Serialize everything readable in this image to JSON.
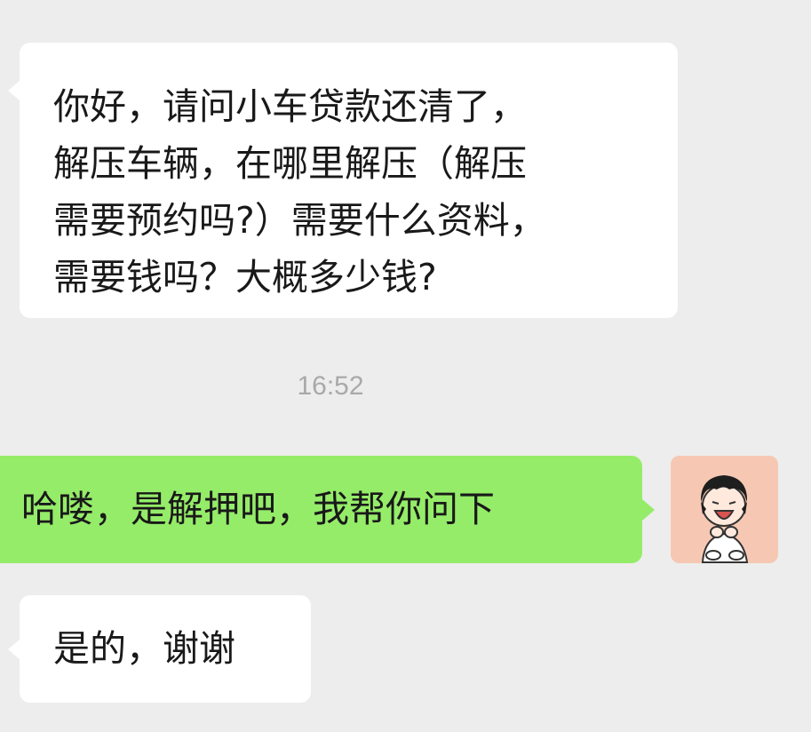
{
  "messages": [
    {
      "sender": "other",
      "text": "你好，请问小车贷款还清了，解压车辆，在哪里解压（解压需要预约吗?）需要什么资料，需要钱吗？大概多少钱?"
    },
    {
      "sender": "self",
      "text": "哈喽，是解押吧，我帮你问下"
    },
    {
      "sender": "other",
      "text": "是的，谢谢"
    }
  ],
  "lines": {
    "m1": [
      "你好，请问小车贷款还清了，",
      "解压车辆，在哪里解压（解压",
      "需要预约吗?）需要什么资料，",
      "需要钱吗？大概多少钱?"
    ]
  },
  "timestamp": "16:52",
  "colors": {
    "background": "#ededed",
    "incoming_bubble": "#ffffff",
    "outgoing_bubble": "#95ec69",
    "timestamp_text": "#a9a9a9"
  },
  "avatar": {
    "icon": "cartoon-girl-avatar"
  }
}
